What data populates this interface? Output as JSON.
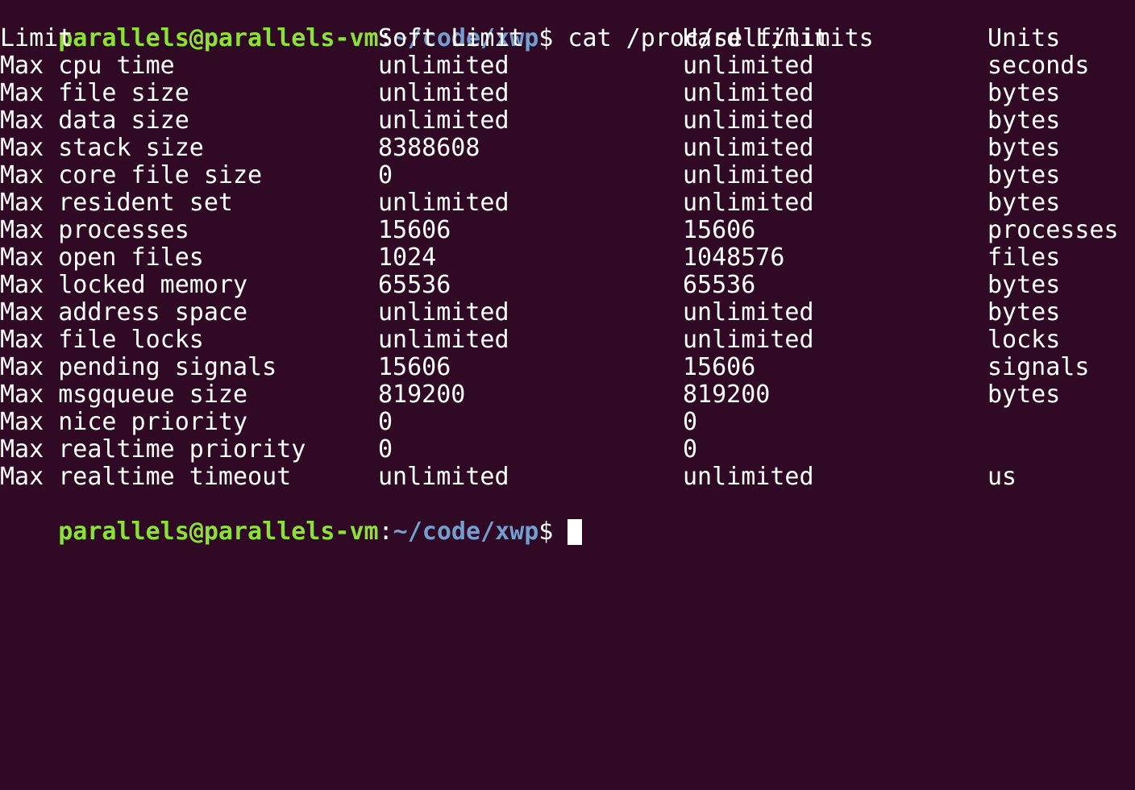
{
  "prompt": {
    "user_host": "parallels@parallels-vm",
    "colon": ":",
    "cwd": "~/code/xwp",
    "dollar": "$",
    "command": " cat /proc/self/limits"
  },
  "table": {
    "headers": [
      "Limit",
      "Soft Limit",
      "Hard Limit",
      "Units"
    ],
    "rows": [
      [
        "Max cpu time",
        "unlimited",
        "unlimited",
        "seconds"
      ],
      [
        "Max file size",
        "unlimited",
        "unlimited",
        "bytes"
      ],
      [
        "Max data size",
        "unlimited",
        "unlimited",
        "bytes"
      ],
      [
        "Max stack size",
        "8388608",
        "unlimited",
        "bytes"
      ],
      [
        "Max core file size",
        "0",
        "unlimited",
        "bytes"
      ],
      [
        "Max resident set",
        "unlimited",
        "unlimited",
        "bytes"
      ],
      [
        "Max processes",
        "15606",
        "15606",
        "processes"
      ],
      [
        "Max open files",
        "1024",
        "1048576",
        "files"
      ],
      [
        "Max locked memory",
        "65536",
        "65536",
        "bytes"
      ],
      [
        "Max address space",
        "unlimited",
        "unlimited",
        "bytes"
      ],
      [
        "Max file locks",
        "unlimited",
        "unlimited",
        "locks"
      ],
      [
        "Max pending signals",
        "15606",
        "15606",
        "signals"
      ],
      [
        "Max msgqueue size",
        "819200",
        "819200",
        "bytes"
      ],
      [
        "Max nice priority",
        "0",
        "0",
        ""
      ],
      [
        "Max realtime priority",
        "0",
        "0",
        ""
      ],
      [
        "Max realtime timeout",
        "unlimited",
        "unlimited",
        "us"
      ]
    ]
  },
  "prompt2": {
    "user_host": "parallels@parallels-vm",
    "colon": ":",
    "cwd": "~/code/xwp",
    "dollar": "$",
    "trailing": " "
  },
  "colors": {
    "background": "#300a24",
    "text": "#ffffff",
    "user_host": "#8ae234",
    "path": "#729fcf"
  }
}
